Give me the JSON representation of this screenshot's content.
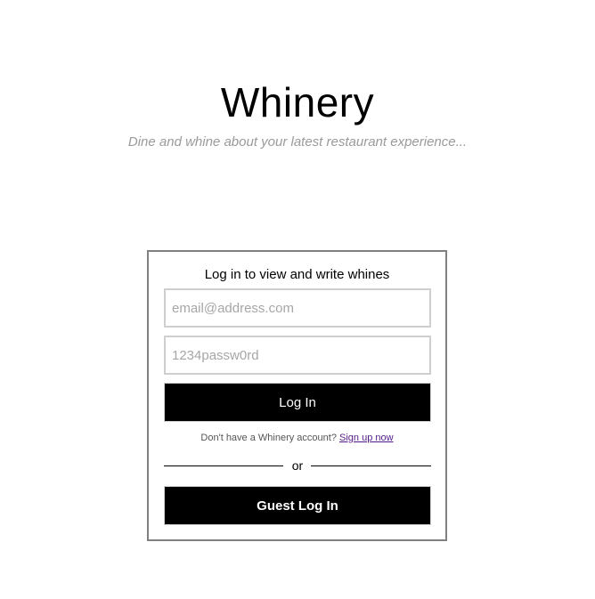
{
  "header": {
    "title": "Whinery",
    "tagline": "Dine and whine about your latest restaurant experience..."
  },
  "login": {
    "heading": "Log in to view and write whines",
    "email_placeholder": "email@address.com",
    "email_value": "",
    "password_placeholder": "1234passw0rd",
    "password_value": "",
    "login_label": "Log In",
    "signup_prompt": "Don't have a Whinery account?",
    "signup_link": "Sign up now",
    "divider_text": "or",
    "guest_label": "Guest Log In"
  },
  "colors": {
    "button_bg": "#000000",
    "button_text": "#ffffff",
    "tagline": "#9a9a9a",
    "card_border": "#808080",
    "link": "#551a8b"
  }
}
